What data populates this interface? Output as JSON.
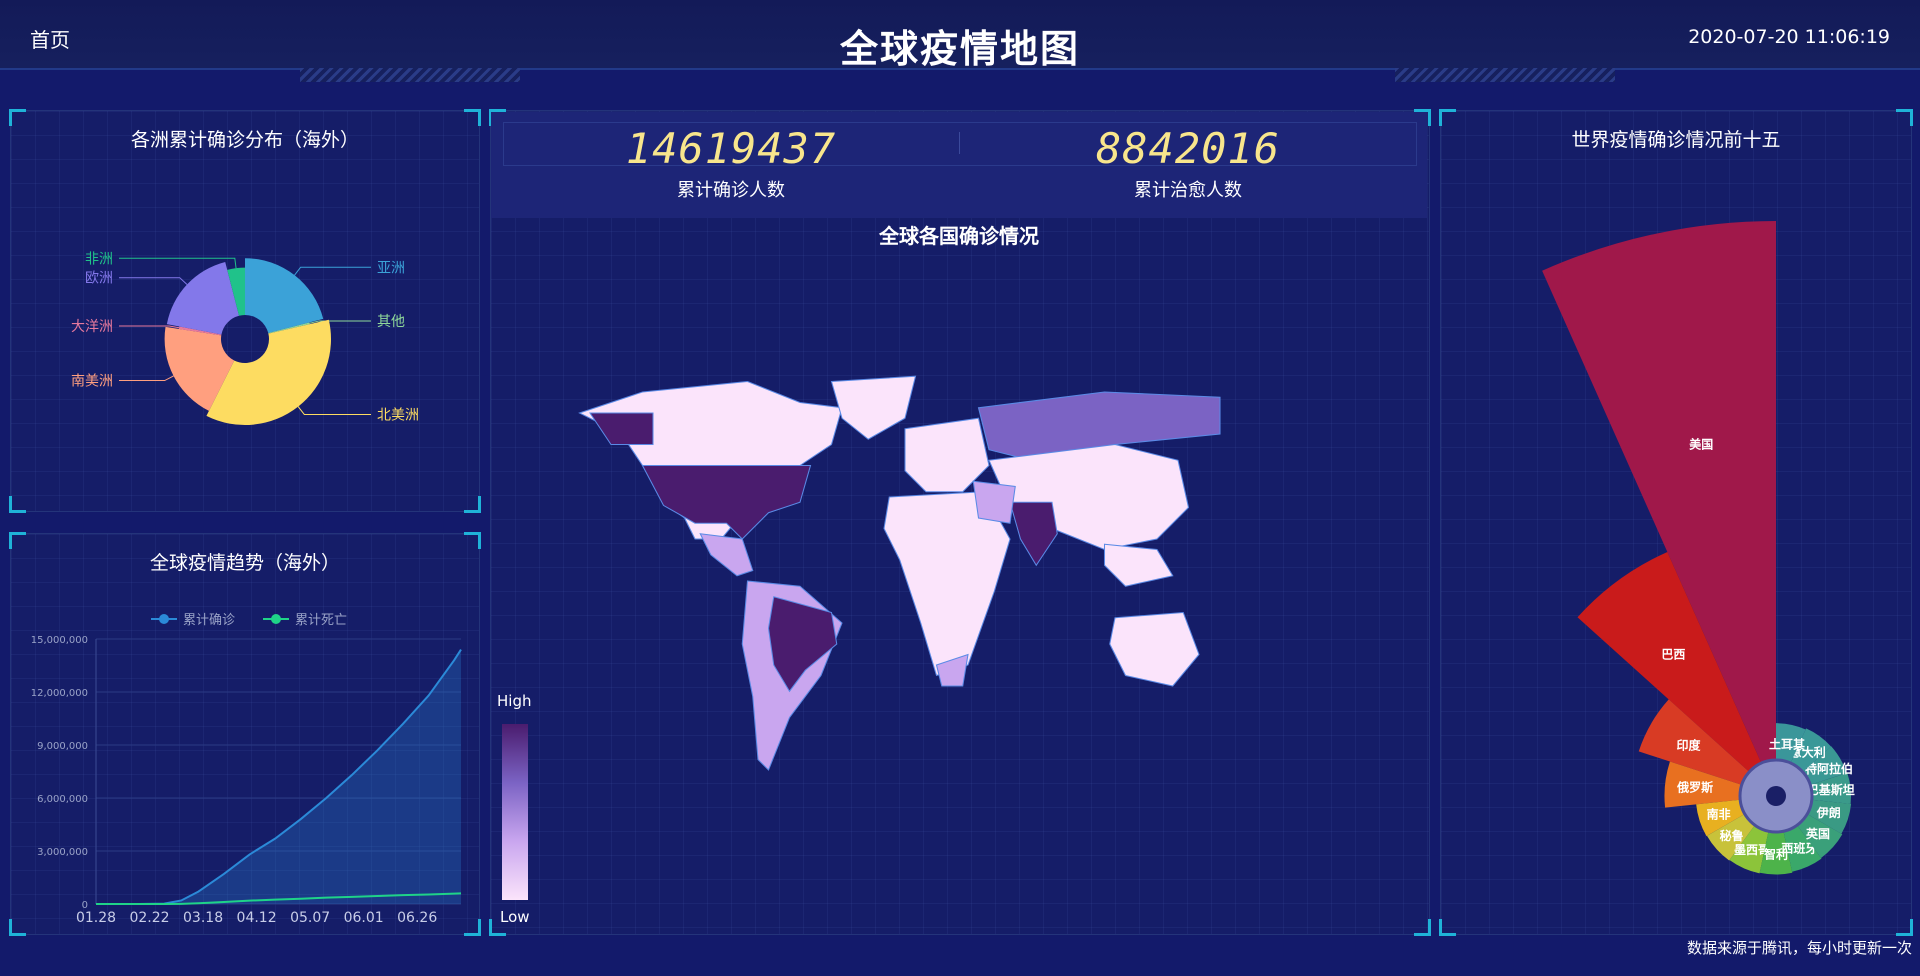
{
  "header": {
    "home": "首页",
    "title": "全球疫情地图",
    "datetime": "2020-07-20 11:06:19"
  },
  "counters": [
    {
      "value": "14619437",
      "label": "累计确诊人数"
    },
    {
      "value": "8842016",
      "label": "累计治愈人数"
    }
  ],
  "footer": "数据来源于腾讯，每小时更新一次",
  "chart_data": [
    {
      "type": "pie",
      "title": "各洲累计确诊分布（海外）",
      "slices": [
        {
          "name": "亚洲",
          "color": "#3ba2d8",
          "value": 21
        },
        {
          "name": "其他",
          "color": "#8fd99a",
          "value": 0.4
        },
        {
          "name": "北美洲",
          "color": "#fddc61",
          "value": 36
        },
        {
          "name": "南美洲",
          "color": "#ff9f7f",
          "value": 20
        },
        {
          "name": "大洋洲",
          "color": "#e7799d",
          "value": 0.6
        },
        {
          "name": "欧洲",
          "color": "#8378ea",
          "value": 18
        },
        {
          "name": "非洲",
          "color": "#20c28a",
          "value": 4
        }
      ]
    },
    {
      "type": "line",
      "title": "全球疫情趋势（海外）",
      "legend": [
        "累计确诊",
        "累计死亡"
      ],
      "x_ticks": [
        "01.28",
        "02.22",
        "03.18",
        "04.12",
        "05.07",
        "06.01",
        "06.26"
      ],
      "y_ticks": [
        "0",
        "3,000,000",
        "6,000,000",
        "9,000,000",
        "12,000,000",
        "15,000,000"
      ],
      "ylim": [
        0,
        15000000
      ],
      "x_days": [
        0,
        25,
        40,
        50,
        60,
        75,
        90,
        105,
        120,
        135,
        150,
        165,
        180,
        195,
        210,
        214
      ],
      "series": [
        {
          "name": "累计确诊",
          "color": "#2b8ad8",
          "values": [
            0,
            0,
            20000,
            200000,
            700000,
            1700000,
            2800000,
            3700000,
            4800000,
            6000000,
            7300000,
            8700000,
            10200000,
            11800000,
            13800000,
            14400000
          ]
        },
        {
          "name": "累计死亡",
          "color": "#1fd388",
          "values": [
            0,
            0,
            800,
            10000,
            40000,
            110000,
            190000,
            250000,
            300000,
            360000,
            400000,
            450000,
            500000,
            540000,
            590000,
            600000
          ]
        }
      ]
    },
    {
      "type": "map",
      "title": "全球各国确诊情况",
      "visual_map": {
        "high": "High",
        "low": "Low",
        "colors": [
          "#4a1c6e",
          "#7b63c4",
          "#c9a6ef",
          "#fbe4fb"
        ]
      }
    },
    {
      "type": "bar",
      "subtype": "nightingale-rose",
      "title": "世界疫情确诊情况前十五",
      "categories": [
        "美国",
        "巴西",
        "印度",
        "俄罗斯",
        "南非",
        "秘鲁",
        "墨西哥",
        "智利",
        "西班牙",
        "英国",
        "伊朗",
        "巴基斯坦",
        "沙特阿拉伯",
        "意大利",
        "土耳其"
      ],
      "values": [
        3900000,
        2100000,
        1120000,
        780000,
        360000,
        350000,
        340000,
        330000,
        310000,
        295000,
        275000,
        265000,
        250000,
        245000,
        220000
      ],
      "colors": [
        "#a0184a",
        "#c91b1b",
        "#d83b24",
        "#e87020",
        "#e8b020",
        "#c8c23a",
        "#8cc43a",
        "#4db34a",
        "#3aa86a",
        "#3aa07a",
        "#3a9a84",
        "#3a9a8a",
        "#3a9894",
        "#3a9898",
        "#3a969a"
      ]
    }
  ]
}
